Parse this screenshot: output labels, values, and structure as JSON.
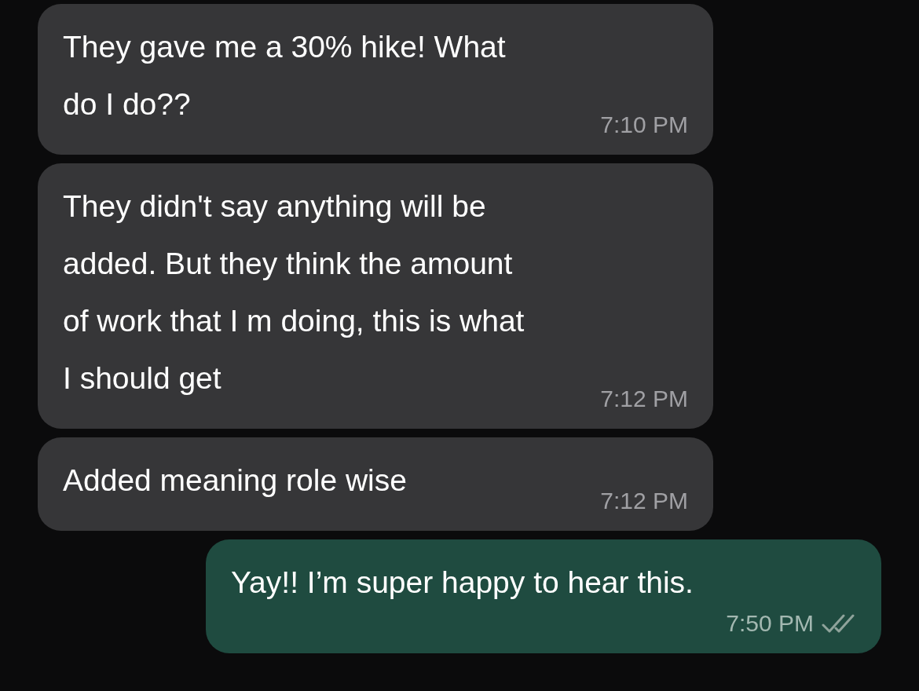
{
  "messages": [
    {
      "outgoing": false,
      "text": "They gave me a 30% hike! What\ndo I do??",
      "time": "7:10 PM"
    },
    {
      "outgoing": false,
      "text": "They didn't say anything will be\nadded. But they think the amount\nof work that I m doing, this is what\nI should get",
      "time": "7:12 PM"
    },
    {
      "outgoing": false,
      "text": "Added meaning role wise",
      "time": "7:12 PM"
    },
    {
      "outgoing": true,
      "text": "Yay!! I’m super happy to hear this.",
      "time": "7:50 PM",
      "read": false
    }
  ]
}
